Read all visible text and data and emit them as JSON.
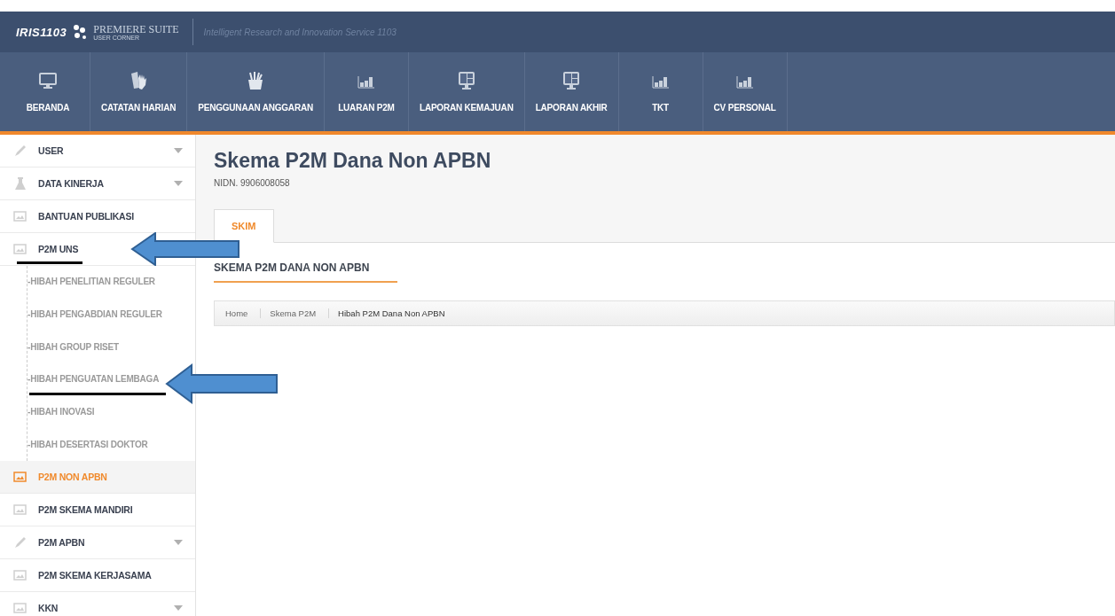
{
  "header": {
    "logo": "IRIS1103",
    "brand": "PREMIERE SUITE",
    "brand_sub": "USER CORNER",
    "tagline": "Intelligent Research and Innovation Service 1103"
  },
  "nav": [
    {
      "label": "BERANDA",
      "kind": "monitor"
    },
    {
      "label": "CATATAN HARIAN",
      "kind": "hand"
    },
    {
      "label": "PENGGUNAAN ANGGARAN",
      "kind": "cup"
    },
    {
      "label": "LUARAN P2M",
      "kind": "chart"
    },
    {
      "label": "LAPORAN KEMAJUAN",
      "kind": "screen"
    },
    {
      "label": "LAPORAN AKHIR",
      "kind": "screen"
    },
    {
      "label": "TKT",
      "kind": "chart"
    },
    {
      "label": "CV PERSONAL",
      "kind": "chart"
    }
  ],
  "sidebar": {
    "items": [
      {
        "label": "USER",
        "kind": "pencil",
        "expandable": true,
        "selected": false
      },
      {
        "label": "DATA KINERJA",
        "kind": "flask",
        "expandable": true,
        "selected": false
      },
      {
        "label": "BANTUAN PUBLIKASI",
        "kind": "screen",
        "expandable": false,
        "selected": false
      },
      {
        "label": "P2M UNS",
        "kind": "screen",
        "expandable": false,
        "selected": false,
        "children": [
          {
            "label": "-HIBAH PENELITIAN REGULER"
          },
          {
            "label": "-HIBAH PENGABDIAN REGULER"
          },
          {
            "label": "-HIBAH GROUP RISET"
          },
          {
            "label": "-HIBAH PENGUATAN LEMBAGA"
          },
          {
            "label": "-HIBAH INOVASI"
          },
          {
            "label": "-HIBAH DESERTASI DOKTOR"
          }
        ]
      },
      {
        "label": "P2M NON APBN",
        "kind": "screen",
        "expandable": false,
        "selected": true
      },
      {
        "label": "P2M SKEMA MANDIRI",
        "kind": "screen",
        "expandable": false,
        "selected": false
      },
      {
        "label": "P2M APBN",
        "kind": "pencil",
        "expandable": true,
        "selected": false
      },
      {
        "label": "P2M SKEMA KERJASAMA",
        "kind": "screen",
        "expandable": false,
        "selected": false
      },
      {
        "label": "KKN",
        "kind": "screen",
        "expandable": true,
        "selected": false
      }
    ]
  },
  "page": {
    "title": "Skema P2M Dana Non APBN",
    "subtitle": "NIDN. 9906008058",
    "tabs": [
      {
        "label": "SKIM",
        "selected": true
      }
    ],
    "section_title": "SKEMA P2M DANA NON APBN",
    "breadcrumb": [
      "Home",
      "Skema P2M",
      "Hibah P2M Dana Non APBN"
    ]
  }
}
